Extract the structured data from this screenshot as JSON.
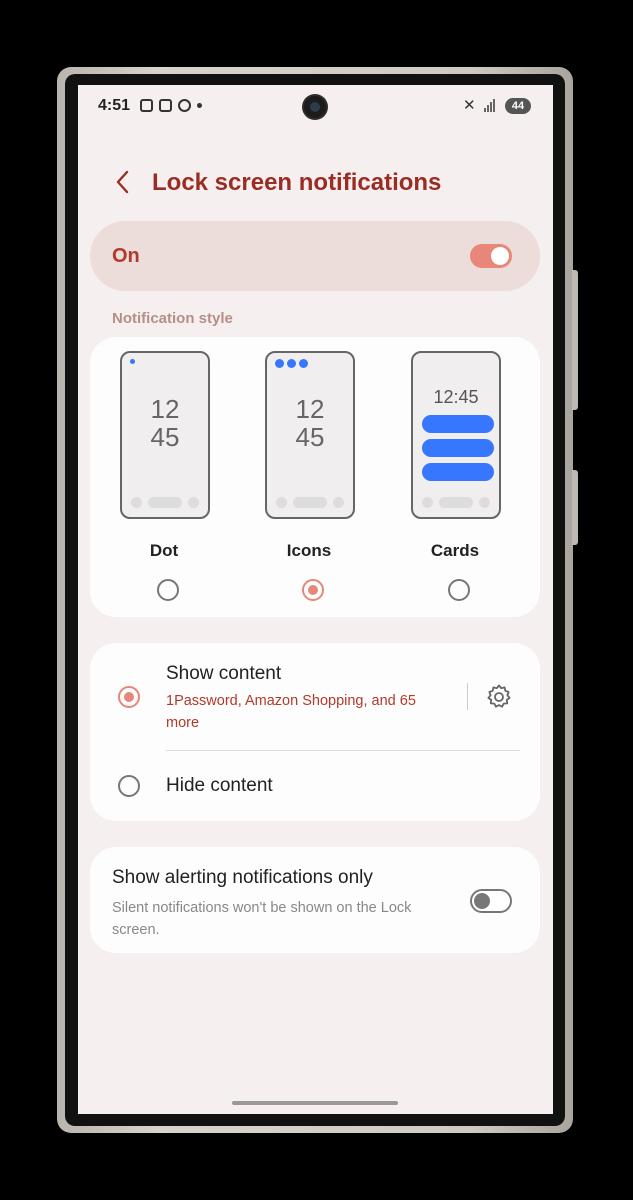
{
  "status_bar": {
    "time": "4:51",
    "battery": "44",
    "icons": [
      "image-icon",
      "sim-icon",
      "check-circle-icon",
      "dot-icon",
      "mute-icon",
      "signal-icon",
      "battery-icon"
    ]
  },
  "header": {
    "title": "Lock screen notifications",
    "back_icon": "chevron-left-icon"
  },
  "master_switch": {
    "label": "On",
    "enabled": true
  },
  "notification_style": {
    "section_label": "Notification style",
    "options": [
      {
        "label": "Dot",
        "clock": [
          "12",
          "45"
        ],
        "selected": false
      },
      {
        "label": "Icons",
        "clock": [
          "12",
          "45"
        ],
        "selected": true
      },
      {
        "label": "Cards",
        "clock": [
          "12:45"
        ],
        "selected": false
      }
    ]
  },
  "content_visibility": {
    "show": {
      "title": "Show content",
      "subtitle": "1Password, Amazon Shopping, and 65 more",
      "selected": true
    },
    "hide": {
      "title": "Hide content",
      "selected": false
    }
  },
  "alerting_only": {
    "title": "Show alerting notifications only",
    "subtitle": "Silent notifications won't be shown on the Lock screen.",
    "enabled": false
  },
  "colors": {
    "accent": "#e7877a",
    "title_red": "#9b2d25",
    "blue": "#3777ff",
    "background": "#f5f0ef"
  }
}
